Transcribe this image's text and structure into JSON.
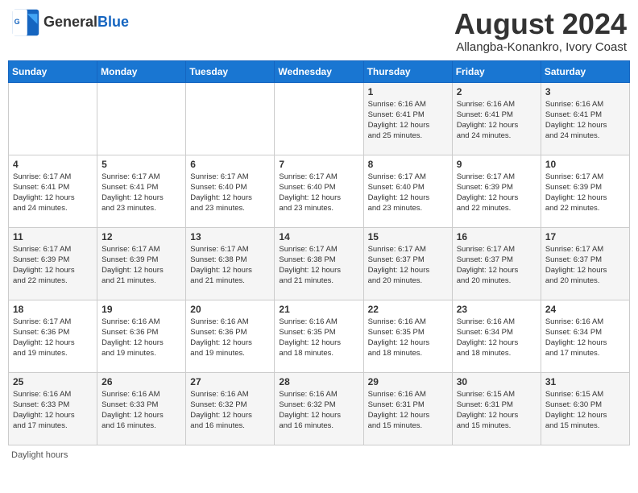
{
  "header": {
    "logo_general": "General",
    "logo_blue": "Blue",
    "title": "August 2024",
    "subtitle": "Allangba-Konankro, Ivory Coast"
  },
  "days_of_week": [
    "Sunday",
    "Monday",
    "Tuesday",
    "Wednesday",
    "Thursday",
    "Friday",
    "Saturday"
  ],
  "weeks": [
    [
      {
        "day": "",
        "info": ""
      },
      {
        "day": "",
        "info": ""
      },
      {
        "day": "",
        "info": ""
      },
      {
        "day": "",
        "info": ""
      },
      {
        "day": "1",
        "info": "Sunrise: 6:16 AM\nSunset: 6:41 PM\nDaylight: 12 hours\nand 25 minutes."
      },
      {
        "day": "2",
        "info": "Sunrise: 6:16 AM\nSunset: 6:41 PM\nDaylight: 12 hours\nand 24 minutes."
      },
      {
        "day": "3",
        "info": "Sunrise: 6:16 AM\nSunset: 6:41 PM\nDaylight: 12 hours\nand 24 minutes."
      }
    ],
    [
      {
        "day": "4",
        "info": "Sunrise: 6:17 AM\nSunset: 6:41 PM\nDaylight: 12 hours\nand 24 minutes."
      },
      {
        "day": "5",
        "info": "Sunrise: 6:17 AM\nSunset: 6:41 PM\nDaylight: 12 hours\nand 23 minutes."
      },
      {
        "day": "6",
        "info": "Sunrise: 6:17 AM\nSunset: 6:40 PM\nDaylight: 12 hours\nand 23 minutes."
      },
      {
        "day": "7",
        "info": "Sunrise: 6:17 AM\nSunset: 6:40 PM\nDaylight: 12 hours\nand 23 minutes."
      },
      {
        "day": "8",
        "info": "Sunrise: 6:17 AM\nSunset: 6:40 PM\nDaylight: 12 hours\nand 23 minutes."
      },
      {
        "day": "9",
        "info": "Sunrise: 6:17 AM\nSunset: 6:39 PM\nDaylight: 12 hours\nand 22 minutes."
      },
      {
        "day": "10",
        "info": "Sunrise: 6:17 AM\nSunset: 6:39 PM\nDaylight: 12 hours\nand 22 minutes."
      }
    ],
    [
      {
        "day": "11",
        "info": "Sunrise: 6:17 AM\nSunset: 6:39 PM\nDaylight: 12 hours\nand 22 minutes."
      },
      {
        "day": "12",
        "info": "Sunrise: 6:17 AM\nSunset: 6:39 PM\nDaylight: 12 hours\nand 21 minutes."
      },
      {
        "day": "13",
        "info": "Sunrise: 6:17 AM\nSunset: 6:38 PM\nDaylight: 12 hours\nand 21 minutes."
      },
      {
        "day": "14",
        "info": "Sunrise: 6:17 AM\nSunset: 6:38 PM\nDaylight: 12 hours\nand 21 minutes."
      },
      {
        "day": "15",
        "info": "Sunrise: 6:17 AM\nSunset: 6:37 PM\nDaylight: 12 hours\nand 20 minutes."
      },
      {
        "day": "16",
        "info": "Sunrise: 6:17 AM\nSunset: 6:37 PM\nDaylight: 12 hours\nand 20 minutes."
      },
      {
        "day": "17",
        "info": "Sunrise: 6:17 AM\nSunset: 6:37 PM\nDaylight: 12 hours\nand 20 minutes."
      }
    ],
    [
      {
        "day": "18",
        "info": "Sunrise: 6:17 AM\nSunset: 6:36 PM\nDaylight: 12 hours\nand 19 minutes."
      },
      {
        "day": "19",
        "info": "Sunrise: 6:16 AM\nSunset: 6:36 PM\nDaylight: 12 hours\nand 19 minutes."
      },
      {
        "day": "20",
        "info": "Sunrise: 6:16 AM\nSunset: 6:36 PM\nDaylight: 12 hours\nand 19 minutes."
      },
      {
        "day": "21",
        "info": "Sunrise: 6:16 AM\nSunset: 6:35 PM\nDaylight: 12 hours\nand 18 minutes."
      },
      {
        "day": "22",
        "info": "Sunrise: 6:16 AM\nSunset: 6:35 PM\nDaylight: 12 hours\nand 18 minutes."
      },
      {
        "day": "23",
        "info": "Sunrise: 6:16 AM\nSunset: 6:34 PM\nDaylight: 12 hours\nand 18 minutes."
      },
      {
        "day": "24",
        "info": "Sunrise: 6:16 AM\nSunset: 6:34 PM\nDaylight: 12 hours\nand 17 minutes."
      }
    ],
    [
      {
        "day": "25",
        "info": "Sunrise: 6:16 AM\nSunset: 6:33 PM\nDaylight: 12 hours\nand 17 minutes."
      },
      {
        "day": "26",
        "info": "Sunrise: 6:16 AM\nSunset: 6:33 PM\nDaylight: 12 hours\nand 16 minutes."
      },
      {
        "day": "27",
        "info": "Sunrise: 6:16 AM\nSunset: 6:32 PM\nDaylight: 12 hours\nand 16 minutes."
      },
      {
        "day": "28",
        "info": "Sunrise: 6:16 AM\nSunset: 6:32 PM\nDaylight: 12 hours\nand 16 minutes."
      },
      {
        "day": "29",
        "info": "Sunrise: 6:16 AM\nSunset: 6:31 PM\nDaylight: 12 hours\nand 15 minutes."
      },
      {
        "day": "30",
        "info": "Sunrise: 6:15 AM\nSunset: 6:31 PM\nDaylight: 12 hours\nand 15 minutes."
      },
      {
        "day": "31",
        "info": "Sunrise: 6:15 AM\nSunset: 6:30 PM\nDaylight: 12 hours\nand 15 minutes."
      }
    ]
  ],
  "footer": {
    "text": "Daylight hours"
  }
}
